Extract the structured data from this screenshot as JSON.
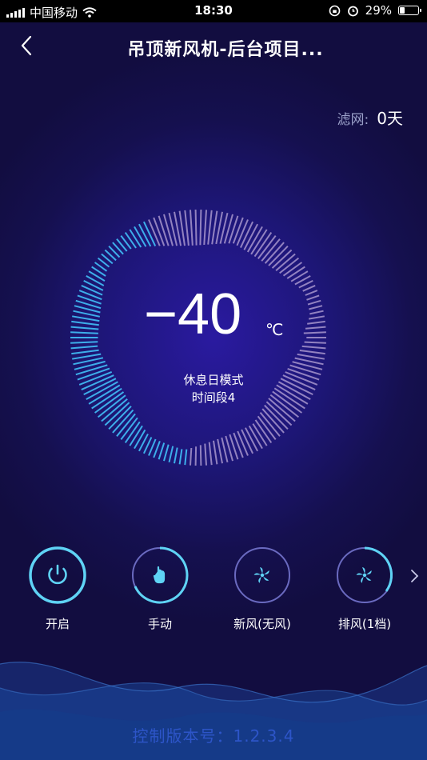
{
  "status_bar": {
    "carrier": "中国移动",
    "time": "18:30",
    "battery": "29%",
    "battery_level": 0.29
  },
  "header": {
    "title": "吊顶新风机-后台项目..."
  },
  "filter": {
    "label": "滤网:",
    "value": "0天"
  },
  "dial": {
    "temperature": "−40",
    "unit": "℃",
    "mode": "休息日模式",
    "period": "时间段4"
  },
  "controls": [
    {
      "label": "开启",
      "icon": "power-icon"
    },
    {
      "label": "手动",
      "icon": "hand-pointer-icon"
    },
    {
      "label": "新风(无风)",
      "icon": "fan-icon"
    },
    {
      "label": "排风(1档)",
      "icon": "fan-icon"
    }
  ],
  "footer": {
    "version": "控制版本号：1.2.3.4"
  },
  "colors": {
    "accent": "#5fd3f5",
    "background": "#1d1676",
    "tick_light": "#b9a7d8",
    "tick_active": "#3fb6f0"
  }
}
